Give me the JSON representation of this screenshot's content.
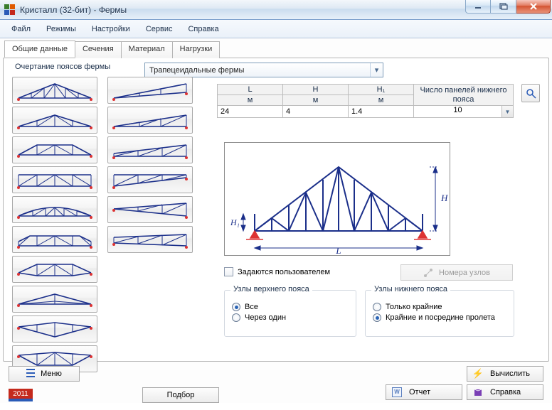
{
  "window": {
    "title": "Кристалл (32-бит) - Фермы"
  },
  "menu": {
    "items": [
      "Файл",
      "Режимы",
      "Настройки",
      "Сервис",
      "Справка"
    ]
  },
  "tabs": {
    "items": [
      "Общие данные",
      "Сечения",
      "Материал",
      "Нагрузки"
    ],
    "active": 0
  },
  "heading": "Очертание поясов фермы",
  "trussTypeCombo": {
    "value": "Трапецеидальные фермы"
  },
  "params": {
    "cols": [
      {
        "head": "L",
        "unit": "м",
        "value": "24"
      },
      {
        "head": "H",
        "unit": "м",
        "value": "4"
      },
      {
        "head": "H₁",
        "unit": "м",
        "value": "1.4"
      }
    ],
    "panelHeader": "Число панелей нижнего пояса",
    "panelValue": "10"
  },
  "checkbox": {
    "label": "Задаются пользователем"
  },
  "disabledBtn": "Номера узлов",
  "groups": {
    "top": {
      "legend": "Узлы верхнего пояса",
      "options": [
        "Все",
        "Через один"
      ],
      "selected": 0
    },
    "bottom": {
      "legend": "Узлы нижнего пояса",
      "options": [
        "Только крайние",
        "Крайние и посредине пролета"
      ],
      "selected": 1
    }
  },
  "bottom": {
    "menu": "Меню",
    "year": "2011",
    "podbor": "Подбор",
    "calc": "Вычислить",
    "report": "Отчет",
    "help": "Справка"
  },
  "diagram": {
    "L": "L",
    "H": "H",
    "H1": "H₁"
  }
}
